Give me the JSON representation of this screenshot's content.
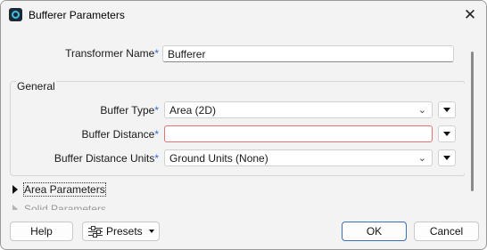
{
  "window": {
    "title": "Bufferer Parameters",
    "icon": "fme-transformer-icon"
  },
  "transformer": {
    "label": "Transformer Name",
    "value": "Bufferer"
  },
  "general": {
    "group_title": "General",
    "buffer_type": {
      "label": "Buffer Type",
      "value": "Area (2D)"
    },
    "buffer_distance": {
      "label": "Buffer Distance",
      "value": ""
    },
    "buffer_units": {
      "label": "Buffer Distance Units",
      "value": "Ground Units (None)"
    }
  },
  "sections": {
    "area": "Area Parameters",
    "solid": "Solid Parameters"
  },
  "required_marker": "*",
  "buttons": {
    "help": "Help",
    "presets": "Presets",
    "ok": "OK",
    "cancel": "Cancel"
  },
  "colors": {
    "error_border": "#e57373",
    "required": "#2a6ee0",
    "primary_border": "#3b6fb6"
  }
}
